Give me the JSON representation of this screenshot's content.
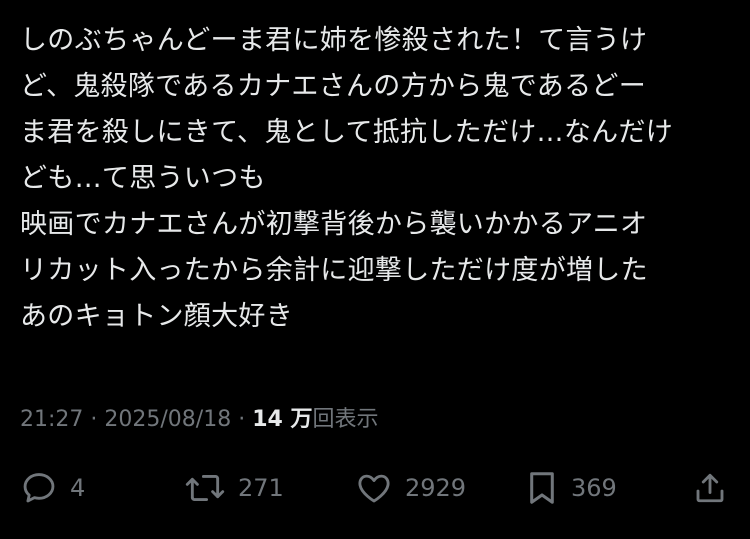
{
  "tweet": {
    "lines": [
      "しのぶちゃんどーま君に姉を惨殺された！て言うけ",
      "ど、鬼殺隊であるカナエさんの方から鬼であるどー",
      "ま君を殺しにきて、鬼として抵抗しただけ…なんだけ",
      "ども…て思ういつも",
      "映画でカナエさんが初撃背後から襲いかかるアニオ",
      "リカット入ったから余計に迎撃しただけ度が増した",
      "あのキョトン顔大好き"
    ]
  },
  "meta": {
    "time": "21:27",
    "separator": " · ",
    "date": "2025/08/18",
    "views_count": "14 万",
    "views_label": "回表示"
  },
  "actions": {
    "reply_count": "4",
    "retweet_count": "271",
    "like_count": "2929",
    "bookmark_count": "369"
  },
  "colors": {
    "background": "#000000",
    "text": "#e7e9ea",
    "secondary": "#71767b"
  },
  "icons": [
    "reply-icon",
    "retweet-icon",
    "like-icon",
    "bookmark-icon",
    "share-icon"
  ]
}
